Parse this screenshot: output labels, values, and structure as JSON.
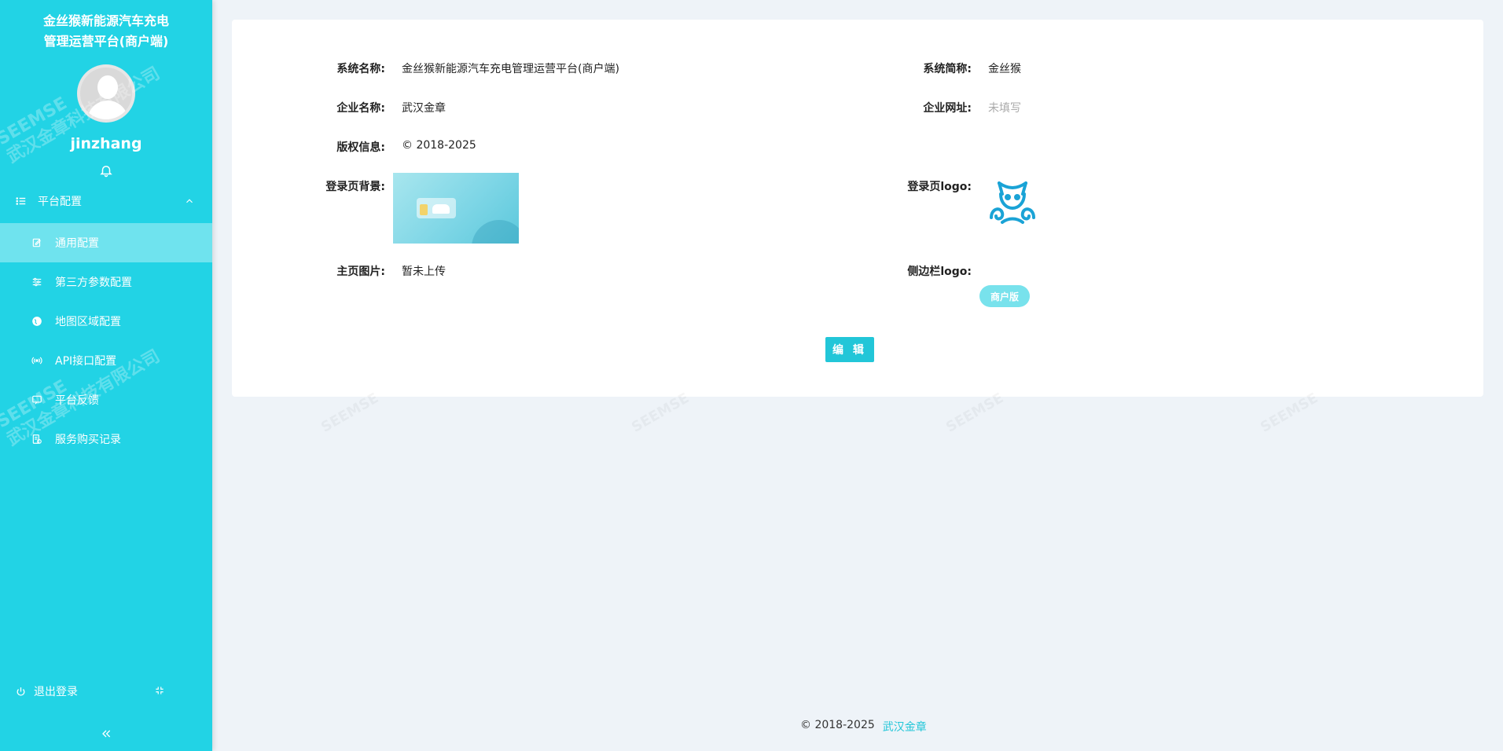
{
  "sidebar": {
    "brand_line1": "金丝猴新能源汽车充电",
    "brand_line2": "管理运营平台(商户端)",
    "username": "jinzhang",
    "group_label": "平台配置",
    "items": [
      {
        "label": "通用配置",
        "icon": "edit-icon"
      },
      {
        "label": "第三方参数配置",
        "icon": "sliders-icon"
      },
      {
        "label": "地图区域配置",
        "icon": "globe-icon"
      },
      {
        "label": "API接口配置",
        "icon": "broadcast-icon"
      },
      {
        "label": "平台反馈",
        "icon": "feedback-icon"
      },
      {
        "label": "服务购买记录",
        "icon": "purchase-icon"
      }
    ],
    "logout_label": "退出登录",
    "watermark_en": "SEEMSE",
    "watermark_cn": "武汉金章科技有限公司"
  },
  "info": {
    "system_name_label": "系统名称:",
    "system_name_value": "金丝猴新能源汽车充电管理运营平台(商户端)",
    "system_short_label": "系统简称:",
    "system_short_value": "金丝猴",
    "company_name_label": "企业名称:",
    "company_name_value": "武汉金章",
    "company_url_label": "企业网址:",
    "company_url_value": "未填写",
    "copyright_label": "版权信息:",
    "copyright_value": "© 2018-2025",
    "login_bg_label": "登录页背景:",
    "login_logo_label": "登录页logo:",
    "home_image_label": "主页图片:",
    "home_image_value": "暂未上传",
    "sidebar_logo_label": "侧边栏logo:",
    "sidebar_logo_badge": "商户版",
    "edit_button": "编 辑"
  },
  "footer": {
    "copyright": "© 2018-2025",
    "company": "武汉金章"
  },
  "colors": {
    "sidebar_bg": "#22d3e5",
    "active_item_bg": "#6fe3ee",
    "accent": "#22c6d8",
    "page_bg": "#eef3f8"
  }
}
